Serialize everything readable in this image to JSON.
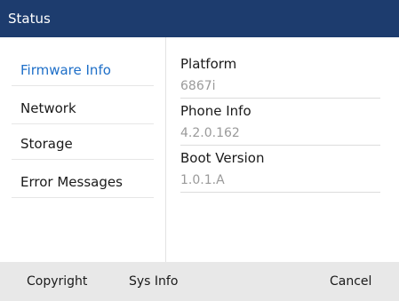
{
  "header": {
    "title": "Status"
  },
  "menu": {
    "items": [
      {
        "label": "Firmware Info",
        "selected": true
      },
      {
        "label": "Network",
        "selected": false
      },
      {
        "label": "Storage",
        "selected": false
      },
      {
        "label": "Error Messages",
        "selected": false
      }
    ]
  },
  "details": {
    "fields": [
      {
        "label": "Platform",
        "value": "6867i"
      },
      {
        "label": "Phone Info",
        "value": "4.2.0.162"
      },
      {
        "label": "Boot Version",
        "value": "1.0.1.A"
      }
    ]
  },
  "softkeys": {
    "copyright": "Copyright",
    "sys_info": "Sys Info",
    "cancel": "Cancel"
  },
  "colors": {
    "title_bar": "#1d3c6e",
    "accent": "#1e6fc8",
    "softkey_bar": "#e8e8e8"
  }
}
